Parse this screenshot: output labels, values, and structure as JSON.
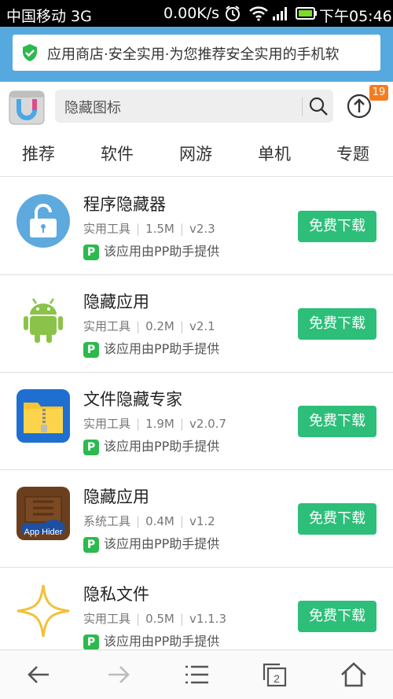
{
  "status_bar": {
    "carrier": "中国移动 3G",
    "speed": "0.00K/s",
    "time": "下午05:46",
    "icons": [
      "alarm-icon",
      "wifi-icon",
      "signal-icon",
      "battery-icon"
    ]
  },
  "banner": {
    "text": "应用商店·安全实用·为您推荐安全实用的手机软",
    "icon": "shield-check-icon"
  },
  "search": {
    "placeholder": "隐藏图标",
    "update_badge": "19"
  },
  "tabs": [
    "推荐",
    "软件",
    "网游",
    "单机",
    "专题"
  ],
  "apps": [
    {
      "name": "程序隐藏器",
      "category": "实用工具",
      "size": "1.5M",
      "version": "v2.3",
      "provider": "该应用由PP助手提供",
      "button": "免费下载",
      "icon": "lock-icon"
    },
    {
      "name": "隐藏应用",
      "category": "实用工具",
      "size": "0.2M",
      "version": "v2.1",
      "provider": "该应用由PP助手提供",
      "button": "免费下载",
      "icon": "android-icon"
    },
    {
      "name": "文件隐藏专家",
      "category": "实用工具",
      "size": "1.9M",
      "version": "v2.0.7",
      "provider": "该应用由PP助手提供",
      "button": "免费下载",
      "icon": "folder-zip-icon"
    },
    {
      "name": "隐藏应用",
      "category": "系统工具",
      "size": "0.4M",
      "version": "v1.2",
      "provider": "该应用由PP助手提供",
      "button": "免费下载",
      "icon": "app-hider-icon",
      "icon_text": "App Hider"
    },
    {
      "name": "隐私文件",
      "category": "实用工具",
      "size": "0.5M",
      "version": "v1.1.3",
      "provider": "该应用由PP助手提供",
      "button": "免费下载",
      "icon": "star-outline-icon"
    }
  ],
  "bottom_nav": [
    "back-icon",
    "forward-icon",
    "menu-icon",
    "tabs-icon",
    "home-icon"
  ],
  "tab_count": "2",
  "colors": {
    "banner": "#55a9df",
    "download_button": "#2dbe7a",
    "pp_green": "#2db94d",
    "badge": "#f47d20"
  }
}
